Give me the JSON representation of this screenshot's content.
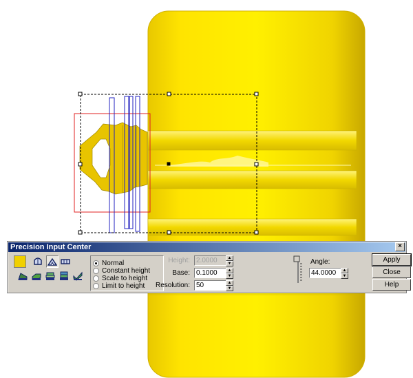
{
  "dialog": {
    "title": "Precision Input Center",
    "close_glyph": "×",
    "color_swatch": "#f0d000",
    "tools_row1": [
      "dome-icon",
      "arch-icon",
      "bevel-icon",
      "flat-icon"
    ],
    "tools_row2": [
      "wedge-icon",
      "slab-icon",
      "layers-icon",
      "stack-icon",
      "check-shape-icon"
    ],
    "modes": [
      {
        "label": "Normal",
        "selected": true
      },
      {
        "label": "Constant height",
        "selected": false
      },
      {
        "label": "Scale to height",
        "selected": false
      },
      {
        "label": "Limit to height",
        "selected": false
      }
    ],
    "fields": {
      "height": {
        "label": "Height:",
        "value": "2.0000",
        "disabled": true
      },
      "base": {
        "label": "Base:",
        "value": "0.1000"
      },
      "resolution": {
        "label": "Resolution:",
        "value": "50"
      },
      "angle": {
        "label": "Angle:",
        "value": "44.0000"
      }
    },
    "buttons": {
      "apply": "Apply",
      "close": "Close",
      "help": "Help"
    }
  },
  "colors": {
    "accent_yellow": "#f0d000",
    "selection_red": "#e02020",
    "selection_blue": "#2020c0"
  }
}
